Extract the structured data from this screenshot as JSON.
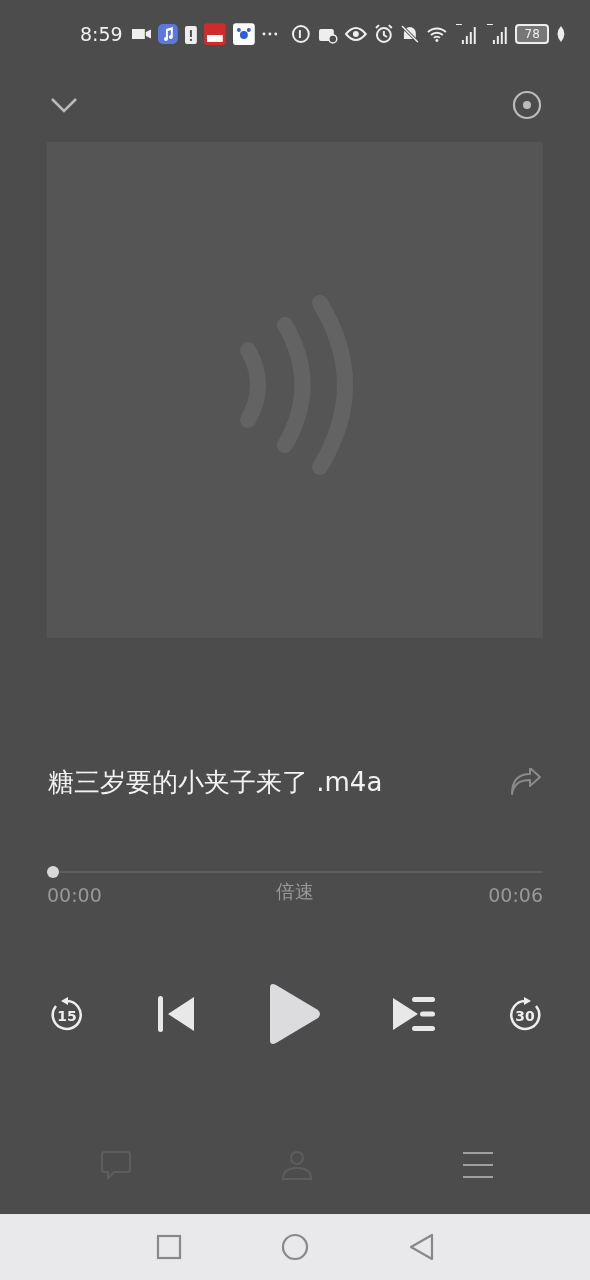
{
  "status_bar": {
    "time": "8:59",
    "battery": "78"
  },
  "track": {
    "title": "糖三岁要的小夹子来了 .m4a"
  },
  "progress": {
    "level": 0,
    "elapsed": "00:00",
    "speed_label": "倍速",
    "duration": "00:06"
  },
  "controls": {
    "rewind": "15",
    "forward": "30",
    "playing": false
  },
  "bottom_tabs": [
    {
      "kind": "comment",
      "disabled": true
    },
    {
      "kind": "person",
      "disabled": true
    },
    {
      "kind": "menu",
      "disabled": false
    }
  ]
}
